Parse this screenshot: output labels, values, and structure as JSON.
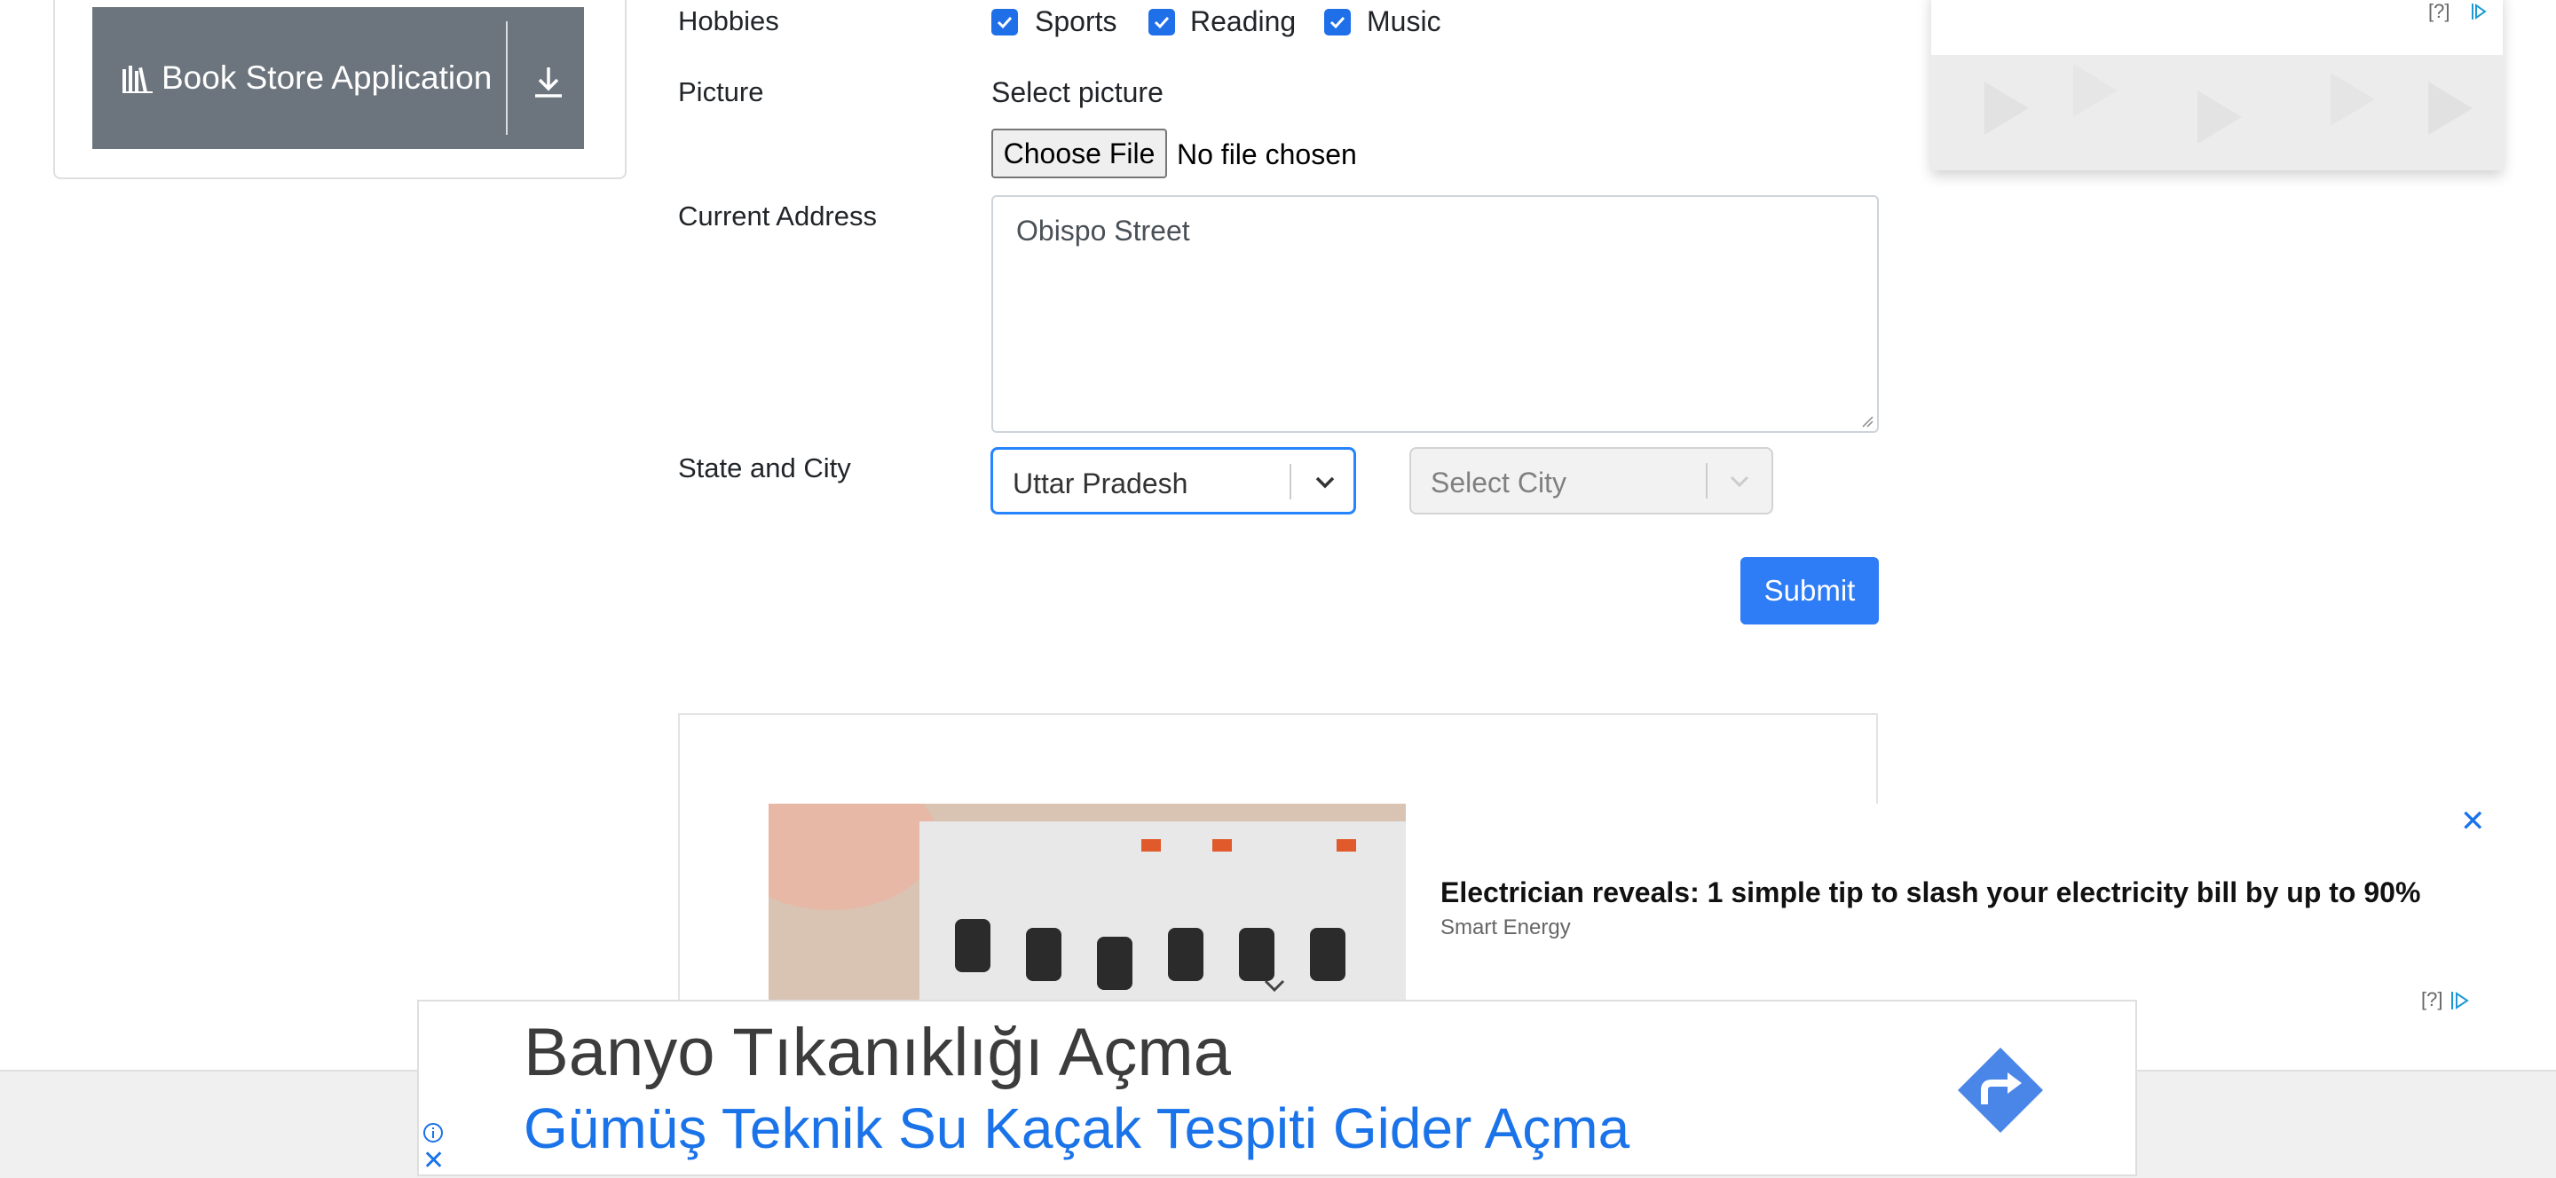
{
  "sidebar": {
    "book_store_label": "Book Store Application"
  },
  "form": {
    "hobbies_label": "Hobbies",
    "hobbies": [
      {
        "label": "Sports",
        "checked": true
      },
      {
        "label": "Reading",
        "checked": true
      },
      {
        "label": "Music",
        "checked": true
      }
    ],
    "picture_label": "Picture",
    "select_picture_text": "Select picture",
    "choose_file_label": "Choose File",
    "no_file_text": "No file chosen",
    "address_label": "Current Address",
    "address_value": "Obispo Street",
    "state_city_label": "State and City",
    "state_value": "Uttar Pradesh",
    "city_placeholder": "Select City",
    "submit_label": "Submit",
    "accent_color": "#2e7cf6"
  },
  "ads": {
    "top_right_marker": "[?]",
    "native_title": "Electrician reveals: 1 simple tip to slash your electricity bill by up to 90%",
    "native_brand": "Smart Energy",
    "native_marker": "[?]",
    "bottom_headline": "Banyo Tıkanıklığı Açma",
    "bottom_subline": "Gümüş Teknik Su Kaçak Tespiti Gider Açma"
  }
}
